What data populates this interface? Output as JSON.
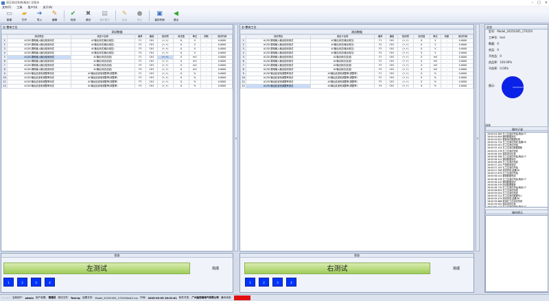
{
  "window": {
    "title": "双压测试系统(服务) 总版本"
  },
  "menu": [
    "文件(F)",
    "工具",
    "用户(U)",
    "关于(A)"
  ],
  "toolbar": [
    {
      "label": "新建",
      "icon": "new-file-icon",
      "glyph": "▭",
      "color": "#7a7a7a",
      "disabled": false
    },
    {
      "label": "打开",
      "icon": "folder-icon",
      "glyph": "▰",
      "color": "#e7b52c",
      "disabled": false
    },
    {
      "label": "导入",
      "icon": "import-icon",
      "glyph": "➔",
      "color": "#3b6fc4",
      "disabled": false
    },
    {
      "label": "编辑",
      "icon": "edit-icon",
      "glyph": "✎",
      "color": "#d8891e",
      "disabled": false
    },
    {
      "label": "检测",
      "icon": "check-icon",
      "glyph": "✔",
      "color": "#2ea82e",
      "disabled": false
    },
    {
      "label": "调试",
      "icon": "tools-icon",
      "glyph": "✖",
      "color": "#6a6a6a",
      "disabled": false
    },
    {
      "label": "通讯模式",
      "icon": "comm-mode-icon",
      "glyph": "▤",
      "color": "#9a9a9a",
      "disabled": true
    },
    {
      "label": "启动",
      "icon": "start-icon",
      "glyph": "✎",
      "color": "#d3b24a",
      "disabled": true
    },
    {
      "label": "停止",
      "icon": "stop-icon",
      "glyph": "●",
      "color": "#9a9a9a",
      "disabled": true
    },
    {
      "label": "保存布局",
      "icon": "save-layout-icon",
      "glyph": "▣",
      "color": "#3b6fc4",
      "disabled": false
    },
    {
      "label": "退出",
      "icon": "exit-icon",
      "glyph": "◀",
      "color": "#2ea82e",
      "disabled": false
    }
  ],
  "left": {
    "panel_title": "左-整体工位",
    "grid_title": "测试数据",
    "status_title": "状态",
    "test_button": "左测试",
    "result": "完成",
    "slots": [
      "1",
      "2",
      "3",
      "4"
    ],
    "selected_row": 5
  },
  "right": {
    "panel_title": "右-整体工位",
    "grid_title": "测试数据",
    "status_title": "状态",
    "test_button": "右测试",
    "result": "完成",
    "slots": [
      "1",
      "2",
      "3",
      "4"
    ],
    "selected_row": 12
  },
  "columns": [
    "",
    "测试项目",
    "测定义名称",
    "编号",
    "通道",
    "检测项",
    "测试值",
    "单位",
    "判断",
    "测试时间"
  ],
  "rows": [
    [
      "1",
      "AC/DC漏电输入输出检测测试",
      "AC输出测试(输出电压)",
      "F1",
      "CH1",
      "(+,+)",
      "0",
      "V",
      "-",
      "0.0000"
    ],
    [
      "2",
      "AC/DC漏电输入输出检测测试",
      "AC输出测试(输出电压)",
      "F2",
      "CH1",
      "(+,+)",
      "0",
      "V",
      "-",
      "0.0000"
    ],
    [
      "3",
      "AC/DC漏电输入输出检测测试",
      "AC输出测试(输出电压)",
      "F3",
      "CH1",
      "(+,+)",
      "0",
      "V",
      "-",
      "0.0000"
    ],
    [
      "4",
      "AC/DC漏电输入输出检测测试",
      "AC输出测试(输出电压)",
      "F4",
      "CH1",
      "(+,+)",
      "0",
      "V",
      "-",
      "0.0000"
    ],
    [
      "5",
      "AC/DC漏电输入输出检测测试",
      "AC输出测试(纹波)",
      "F1",
      "CH1",
      "(+,+)",
      "0",
      "mV",
      "-",
      "0.0000"
    ],
    [
      "6",
      "AC/DC漏电输入输出检测测试",
      "AC输出测试(纹波)",
      "F2",
      "CH1",
      "(+,+)",
      "0",
      "mV",
      "-",
      "0.0000"
    ],
    [
      "7",
      "AC/DC漏电输入输出检测测试",
      "AC输出测试(纹波)",
      "F3",
      "CH1",
      "(+,+)",
      "0",
      "mV",
      "-",
      "0.0000"
    ],
    [
      "8",
      "AC/DC漏电输入输出检测测试",
      "AC输出测试(纹波)",
      "F4",
      "CH1",
      "(+,+)",
      "0",
      "mV",
      "-",
      "0.0000"
    ],
    [
      "9",
      "AC/DC输出纹波电调整率测试",
      "AC输出纹波电调整率(调整率)",
      "F1",
      "CH1",
      "(+,+)",
      "0",
      "%",
      "-",
      "0.0000"
    ],
    [
      "10",
      "AC/DC输出纹波电调整率测试",
      "AC输出纹波电调整率(调整率)",
      "F2",
      "CH1",
      "(+,+)",
      "0",
      "%",
      "-",
      "0.0000"
    ],
    [
      "11",
      "AC/DC输出纹波电调整率测试",
      "AC输出纹波电调整率(调整率)",
      "F3",
      "CH1",
      "(+,+)",
      "0",
      "%",
      "-",
      "0.0000"
    ],
    [
      "12",
      "AC/DC输出纹波电调整率测试",
      "AC输出纹波电调整率(调整率)",
      "F4",
      "CH1",
      "(+,+)",
      "0",
      "%",
      "-",
      "0.0000"
    ]
  ],
  "info": {
    "panel_title": "总览",
    "fields": [
      {
        "label": "型号:",
        "value": "Model_20250305_170250"
      },
      {
        "label": "工单号:",
        "value": "test"
      },
      {
        "label": "数量:",
        "value": "0"
      },
      {
        "label": "良品:",
        "value": "0"
      },
      {
        "label": "不良品:",
        "value": "0"
      },
      {
        "label": "良品率:",
        "value": "100.00%"
      },
      {
        "label": "不良率:",
        "value": "0.00%"
      }
    ],
    "pie_label": "图示:",
    "pie_color": "#0a22e8",
    "yield_fraction": 1.0
  },
  "log": {
    "title": "操作记录",
    "header": "消息",
    "lines": [
      "16:00:54.589 左工位测试开始,剩余1个",
      "16:00:54.609 通讯数据测试",
      "16:00:54.622 更新测试数据完成",
      "16:00:54.724 左工位测试完成,结果OK",
      "16:00:55.001 右工位测试开始",
      "16:00:55.104 右工位测试数据更新",
      "16:00:55.278 右工位测试完成",
      "16:00:56.345 保存测试记录",
      "16:00:56.398 左工位测试开始,剩余1个",
      "16:00:56.412 通讯数据测试",
      "16:00:56.489 左工位测试完成",
      "16:00:57.102 产品检测测试",
      "16:00:57.245 右工位测试开始",
      "16:00:57.398 测试完成,结果OK",
      "16:00:57.876 左工位测试开始",
      "16:00:58.014 更新数据完成",
      "16:00:58.226 左工位测试开始,剩余1个",
      "16:00:58.410 通讯数据测试",
      "16:00:58.578 测试数据更新",
      "16:00:58.719 右工位测试开始,剩余1个",
      "16:00:58.893 右工位测试完成",
      "16:00:59.004 左工位测试完成",
      "16:00:59.312 右工位测试数据写入",
      "16:00:59.479 测试完成,结果OK",
      "16:00:59.688 检测左工位测试完成",
      "16:00:59.902 保存测试记录",
      "16:01:00.123 左工位测试开始,剩余1个",
      "16:01:00.367 右工位测试数据更新完成",
      "16:01:00.492 右工位测试完成",
      "16:01:00.714 保存测试布局",
      "16:01:00.901 测试完成",
      "16:01:01.015 复位完成"
    ]
  },
  "prompt": {
    "title": "操作提示"
  },
  "statusbar": {
    "user_label": "当前用户:",
    "user": "admin",
    "role_label": "用户权限:",
    "role": "管理员",
    "file_label": "测试文件:",
    "file": "Test.tp",
    "result_label": "结果文件:",
    "result": "Model_20250305_170250test2.csv",
    "time_label": "时间:",
    "time": "2025-03-05 16:01:01",
    "company_label": "软件开发:",
    "company": "广州金铠瑞电气有限公司",
    "conn_label": "通讯状态:",
    "conn": "",
    "alarm_color": "#e01010"
  }
}
